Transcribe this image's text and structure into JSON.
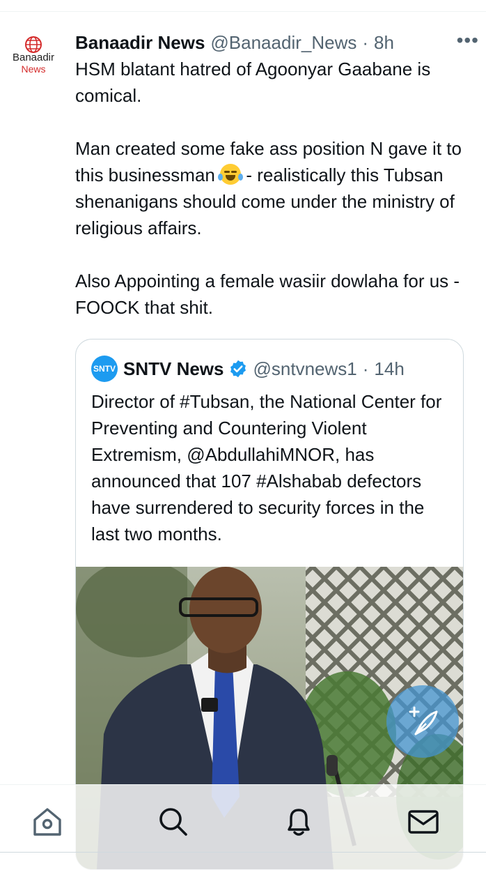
{
  "tweet": {
    "avatar": {
      "line1": "Banaadir",
      "line2": "News"
    },
    "name": "Banaadir News",
    "handle": "@Banaadir_News",
    "separator": "·",
    "time": "8h",
    "more": "•••",
    "paragraphs": [
      "HSM blatant hatred of Agoonyar Gaabane is comical.",
      "Man created some fake ass position N gave it to this businessman",
      "- realistically this Tubsan shenanigans should come under the ministry of religious affairs.",
      "Also Appointing a female wasiir dowlaha for us - FOOCK that shit."
    ],
    "emoji_name": "face-with-tears-of-joy-emoji"
  },
  "quoted": {
    "avatar_text": "SNTV",
    "name": "SNTV News",
    "verified_icon": "verified-badge-icon",
    "handle": "@sntvnews1",
    "separator": "·",
    "time": "14h",
    "text": "Director of #Tubsan, the National Center for Preventing and Countering Violent Extremism, @AbdullahiMNOR, has announced that 107 #Alshabab defectors have surrendered to security forces in the last two months.",
    "image_alt": "photo-man-in-suit-at-microphone"
  },
  "fab": {
    "icon": "compose-post-icon"
  },
  "tabbar": {
    "items": [
      {
        "icon": "home-icon"
      },
      {
        "icon": "search-icon"
      },
      {
        "icon": "notifications-bell-icon"
      },
      {
        "icon": "messages-envelope-icon"
      }
    ]
  },
  "colors": {
    "accent": "#1d9bf0",
    "text": "#0f1419",
    "secondary": "#536471",
    "border": "#cfd9de",
    "brand_red": "#d42b2b"
  }
}
